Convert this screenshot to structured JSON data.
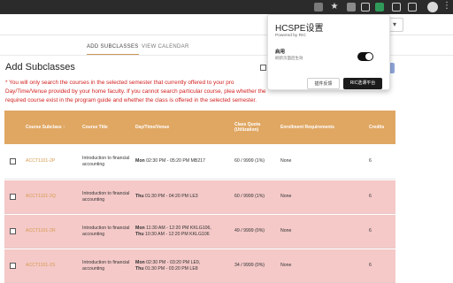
{
  "browser": {
    "extension_icons": [
      "extension-icon",
      "bookmark-star-icon",
      "extension-icon",
      "extension-icon",
      "active-extension-icon",
      "tabs-icon",
      "sidebar-icon"
    ],
    "menu_glyph": "⋮"
  },
  "tabs": [
    {
      "label": "ADD SUBCLASSES"
    },
    {
      "label": "VIEW CALENDAR"
    }
  ],
  "page": {
    "title": "Add Subclasses",
    "notice": "* You will only search the courses in the selected semester that currently offered to your pro Day/Time/Venue provided by your home faculty. If you cannot search particular course, plea whether the required course exist in the program guide and whether the class is offered in the selected semester."
  },
  "table": {
    "headers": {
      "subclass": "Course Subclass ↑",
      "title": "Course Title",
      "datetime": "Day/Time/Venue",
      "quota": "Class Quota (Utilization)",
      "enrollment": "Enrollment Requirements",
      "credits": "Credits"
    },
    "rows": [
      {
        "code": "ACCT1101-2P",
        "title": "Introduction to financial accounting",
        "schedule": [
          {
            "day": "Mon",
            "detail": "02:30 PM - 05:20 PM MB217"
          }
        ],
        "quota": "60 / 9999 (1%)",
        "requirements": "None",
        "credits": "6",
        "highlight": false
      },
      {
        "code": "ACCT1101-2Q",
        "title": "Introduction to financial accounting",
        "schedule": [
          {
            "day": "Thu",
            "detail": "01:30 PM - 04:20 PM LE3"
          }
        ],
        "quota": "60 / 9999 (1%)",
        "requirements": "None",
        "credits": "6",
        "highlight": true
      },
      {
        "code": "ACCT1101-2R",
        "title": "Introduction to financial accounting",
        "schedule": [
          {
            "day": "Mon",
            "detail": "11:30 AM - 12:20 PM KKLG106,"
          },
          {
            "day": "Thu",
            "detail": "10:30 AM - 12:20 PM KKLG106"
          }
        ],
        "quota": "49 / 9999 (0%)",
        "requirements": "None",
        "credits": "6",
        "highlight": true
      },
      {
        "code": "ACCT1101-2S",
        "title": "Introduction to financial accounting",
        "schedule": [
          {
            "day": "Mon",
            "detail": "02:30 PM - 03:20 PM LE9,"
          },
          {
            "day": "Thu",
            "detail": "01:30 PM - 03:20 PM LE8"
          }
        ],
        "quota": "34 / 9999 (0%)",
        "requirements": "None",
        "credits": "6",
        "highlight": true
      }
    ]
  },
  "popup": {
    "title": "HCSPE设置",
    "subtitle": "Powered by RIC",
    "setting_label": "启用",
    "setting_desc": "刷新页面后生效",
    "toggle_on": true,
    "feedback_button": "插件反馈",
    "platform_button": "RIC选课平台"
  },
  "colors": {
    "header_bg": "#e0a763",
    "row_highlight": "#f4c9c8",
    "notice_text": "#d21f1f",
    "course_code": "#d89a4e"
  }
}
